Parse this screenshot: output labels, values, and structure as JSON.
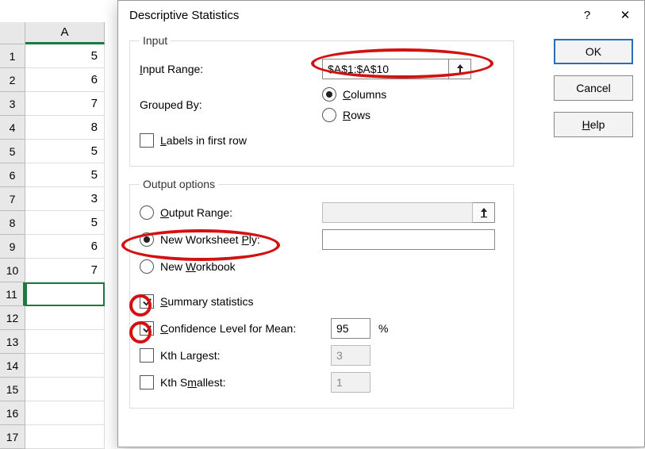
{
  "sheet": {
    "col_header": "A",
    "selected_row": 11,
    "rows": [
      {
        "n": 1,
        "v": "5"
      },
      {
        "n": 2,
        "v": "6"
      },
      {
        "n": 3,
        "v": "7"
      },
      {
        "n": 4,
        "v": "8"
      },
      {
        "n": 5,
        "v": "5"
      },
      {
        "n": 6,
        "v": "5"
      },
      {
        "n": 7,
        "v": "3"
      },
      {
        "n": 8,
        "v": "5"
      },
      {
        "n": 9,
        "v": "6"
      },
      {
        "n": 10,
        "v": "7"
      },
      {
        "n": 11,
        "v": ""
      },
      {
        "n": 12,
        "v": ""
      },
      {
        "n": 13,
        "v": ""
      },
      {
        "n": 14,
        "v": ""
      },
      {
        "n": 15,
        "v": ""
      },
      {
        "n": 16,
        "v": ""
      },
      {
        "n": 17,
        "v": ""
      }
    ]
  },
  "dialog": {
    "title": "Descriptive Statistics",
    "help_symbol": "?",
    "close_symbol": "✕"
  },
  "buttons": {
    "ok": "OK",
    "cancel": "Cancel",
    "help": "Help",
    "help_u": "H"
  },
  "input": {
    "legend": "Input",
    "range_label_pre": "I",
    "range_label": "nput Range:",
    "range_value": "$A$1:$A$10",
    "grouped_label": "Grouped By:",
    "columns_pre": "C",
    "columns": "olumns",
    "rows_pre": "R",
    "rows": "ows",
    "labels_pre": "L",
    "labels": "abels in first row"
  },
  "output": {
    "legend": "Output options",
    "range_pre": "O",
    "range": "utput Range:",
    "ply_pre_text": "New Worksheet ",
    "ply_u": "P",
    "ply_post": "ly:",
    "workbook_pre": "New ",
    "workbook_u": "W",
    "workbook_post": "orkbook",
    "summary_pre": "S",
    "summary": "ummary statistics",
    "conf_pre": "C",
    "conf": "onfidence Level for Mean:",
    "conf_value": "95",
    "percent": "%",
    "kth_largest": "Kth Largest:",
    "kth_l_value": "3",
    "kth_s_pre": "Kth S",
    "kth_s_u": "m",
    "kth_s_post": "allest:",
    "kth_s_value": "1"
  }
}
